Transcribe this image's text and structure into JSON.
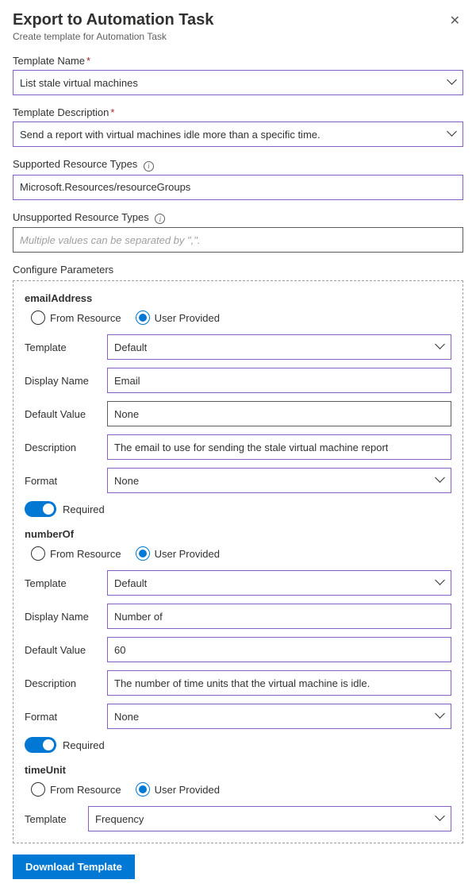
{
  "header": {
    "title": "Export to Automation Task",
    "subtitle": "Create template for Automation Task"
  },
  "fields": {
    "template_name": {
      "label": "Template Name",
      "value": "List stale virtual machines"
    },
    "template_description": {
      "label": "Template Description",
      "value": "Send a report with virtual machines idle more than a specific time."
    },
    "supported": {
      "label": "Supported Resource Types",
      "value": "Microsoft.Resources/resourceGroups"
    },
    "unsupported": {
      "label": "Unsupported Resource Types",
      "placeholder": "Multiple values can be separated by \",\"."
    }
  },
  "configure_label": "Configure Parameters",
  "radio_labels": {
    "from_resource": "From Resource",
    "user_provided": "User Provided"
  },
  "row_labels": {
    "template": "Template",
    "display_name": "Display Name",
    "default_value": "Default Value",
    "description": "Description",
    "format": "Format"
  },
  "required_label": "Required",
  "params": {
    "emailAddress": {
      "name": "emailAddress",
      "template": "Default",
      "display_name": "Email",
      "default_value": "None",
      "description": "The email to use for sending the stale virtual machine report",
      "format": "None"
    },
    "numberOf": {
      "name": "numberOf",
      "template": "Default",
      "display_name": "Number of",
      "default_value": "60",
      "description": "The number of time units that the virtual machine is idle.",
      "format": "None"
    },
    "timeUnit": {
      "name": "timeUnit",
      "template": "Frequency"
    }
  },
  "download_label": "Download Template"
}
